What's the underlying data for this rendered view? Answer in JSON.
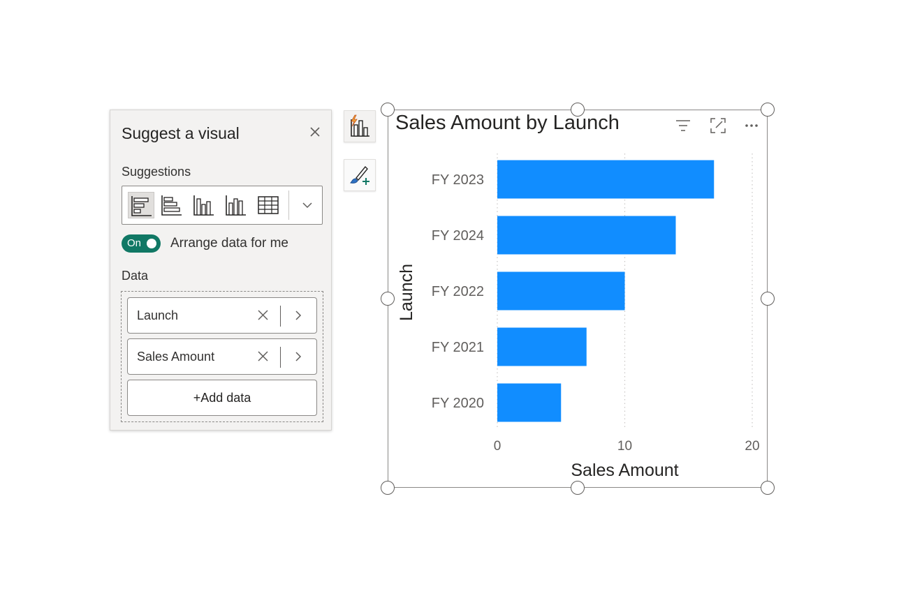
{
  "panel": {
    "title": "Suggest a visual",
    "suggestions_label": "Suggestions",
    "toggle_text": "On",
    "arrange_label": "Arrange data for me",
    "data_label": "Data",
    "fields": [
      {
        "label": "Launch"
      },
      {
        "label": "Sales Amount"
      }
    ],
    "add_data_label": "+Add data",
    "suggestion_icons": [
      "stacked-bar-chart-icon",
      "clustered-bar-chart-icon",
      "stacked-column-chart-icon",
      "clustered-column-chart-icon",
      "table-icon"
    ],
    "accent": "#117865"
  },
  "visual": {
    "header_icons": [
      "filter-icon",
      "focus-mode-icon",
      "more-options-icon"
    ]
  },
  "chart_data": {
    "type": "bar",
    "orientation": "horizontal",
    "title": "Sales Amount by Launch",
    "xlabel": "Sales Amount",
    "ylabel": "Launch",
    "categories": [
      "FY 2023",
      "FY 2024",
      "FY 2022",
      "FY 2021",
      "FY 2020"
    ],
    "values": [
      17,
      14,
      10,
      7,
      5
    ],
    "xlim": [
      0,
      20
    ],
    "xticks": [
      "0",
      "10",
      "20"
    ],
    "grid": "vertical dotted",
    "bar_color": "#118DFF"
  }
}
